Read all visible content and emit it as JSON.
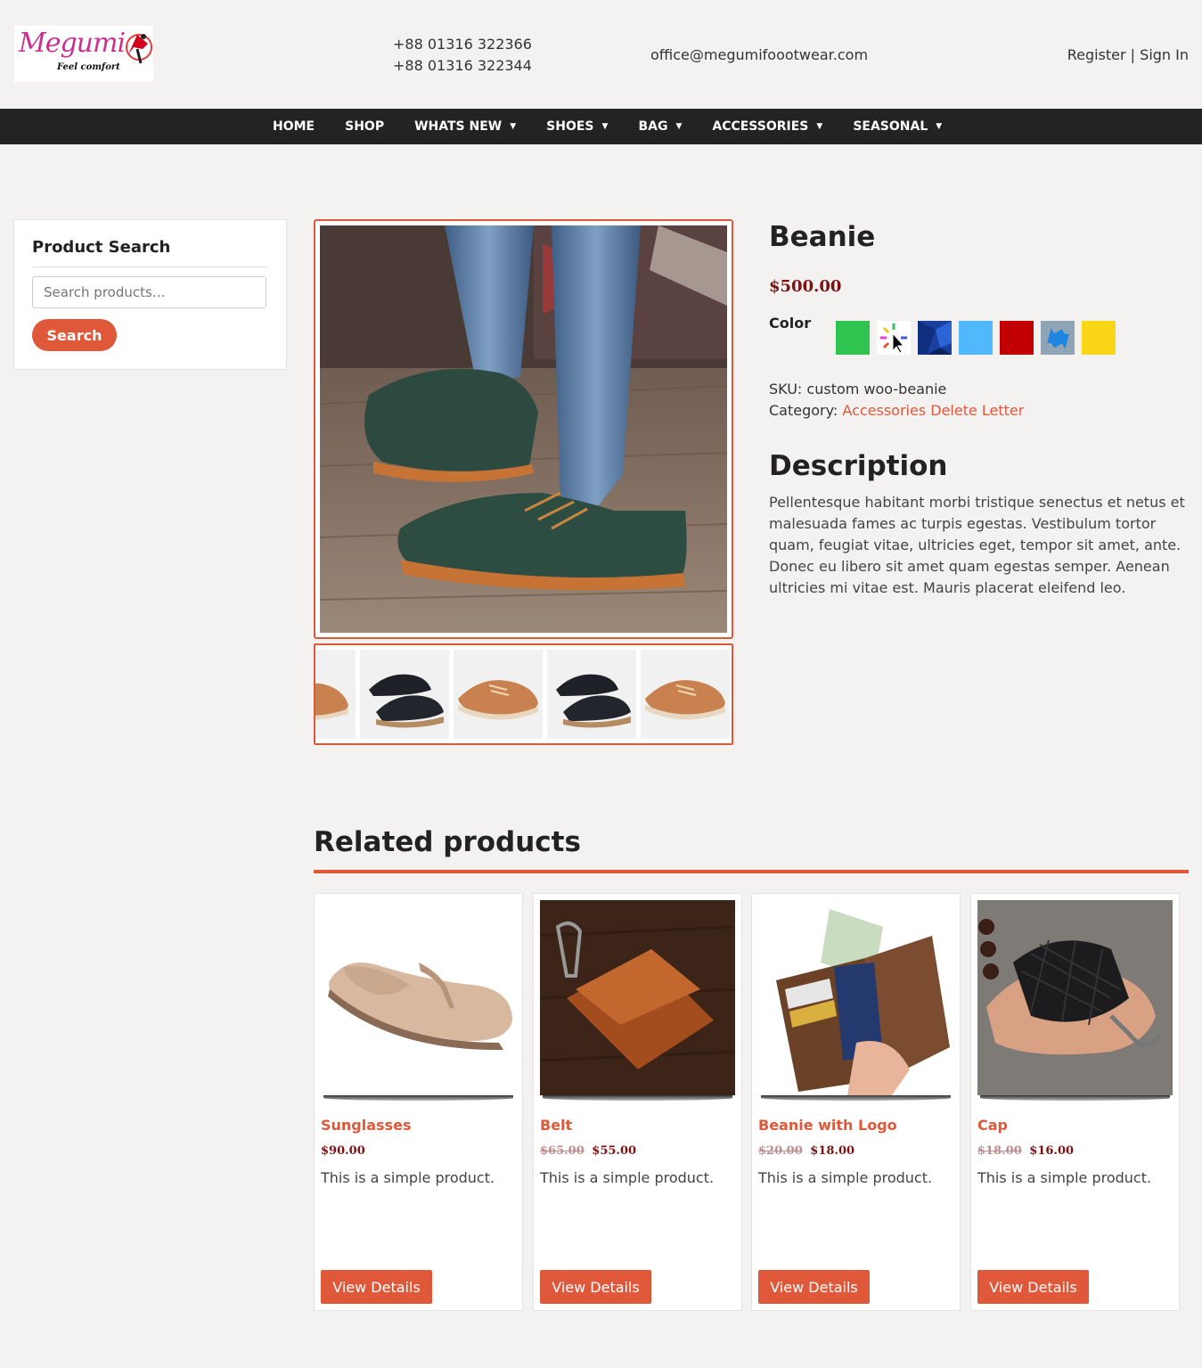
{
  "header": {
    "logo_text": "Megumi",
    "logo_tagline": "Feel comfort",
    "phones": [
      "+88 01316 322366",
      "+88 01316 322344"
    ],
    "email": "office@megumifoootwear.com",
    "register": "Register",
    "separator": "|",
    "sign_in": "Sign In"
  },
  "nav": {
    "items": [
      {
        "label": "HOME",
        "has_dropdown": false
      },
      {
        "label": "SHOP",
        "has_dropdown": false
      },
      {
        "label": "WHATS NEW",
        "has_dropdown": true
      },
      {
        "label": "SHOES",
        "has_dropdown": true
      },
      {
        "label": "BAG",
        "has_dropdown": true
      },
      {
        "label": "ACCESSORIES",
        "has_dropdown": true
      },
      {
        "label": "SEASONAL",
        "has_dropdown": true
      }
    ],
    "caret": "▼"
  },
  "sidebar": {
    "title": "Product Search",
    "search_placeholder": "Search products…",
    "search_button": "Search"
  },
  "product": {
    "title": "Beanie",
    "price": "$500.00",
    "color_label": "Color",
    "swatches": [
      {
        "type": "solid",
        "color": "#2fc350"
      },
      {
        "type": "icon",
        "name": "loading-cursor-icon"
      },
      {
        "type": "pattern",
        "name": "blue-polygon-pattern",
        "color": "#1a3f9e"
      },
      {
        "type": "solid",
        "color": "#50b9fb"
      },
      {
        "type": "solid",
        "color": "#c20002"
      },
      {
        "type": "icon",
        "name": "refresh-arrows-icon",
        "color": "#8fa4b5"
      },
      {
        "type": "solid",
        "color": "#fad619"
      }
    ],
    "sku_label": "SKU:",
    "sku": "custom woo-beanie",
    "category_label": "Category:",
    "category": "Accessories Delete Letter",
    "description_title": "Description",
    "description": "Pellentesque habitant morbi tristique senectus et netus et malesuada fames ac turpis egestas. Vestibulum tortor quam, feugiat vitae, ultricies eget, tempor sit amet, ante. Donec eu libero sit amet quam egestas semper. Aenean ultricies mi vitae est. Mauris placerat eleifend leo."
  },
  "gallery": {
    "main_image": "green-suede-shoe-photo",
    "thumbnails": [
      "tan-shoe-thumb",
      "black-oxford-thumb",
      "tan-shoe-thumb",
      "black-oxford-thumb",
      "tan-shoe-thumb"
    ]
  },
  "related": {
    "title": "Related products",
    "products": [
      {
        "name": "Sunglasses",
        "old_price": "",
        "price": "$90.00",
        "text": "This is a simple product.",
        "button": "View Details",
        "image": "beige-loafer-photo"
      },
      {
        "name": "Belt",
        "old_price": "$65.00",
        "price": "$55.00",
        "text": "This is a simple product.",
        "button": "View Details",
        "image": "brown-key-wallet-photo"
      },
      {
        "name": "Beanie with Logo",
        "old_price": "$20.00",
        "price": "$18.00",
        "text": "This is a simple product.",
        "button": "View Details",
        "image": "passport-wallet-photo"
      },
      {
        "name": "Cap",
        "old_price": "$18.00",
        "price": "$16.00",
        "text": "This is a simple product.",
        "button": "View Details",
        "image": "black-woven-key-case-photo"
      }
    ]
  },
  "colors": {
    "accent": "#e0583a",
    "price": "#7d1112",
    "nav_bg": "#232323"
  }
}
